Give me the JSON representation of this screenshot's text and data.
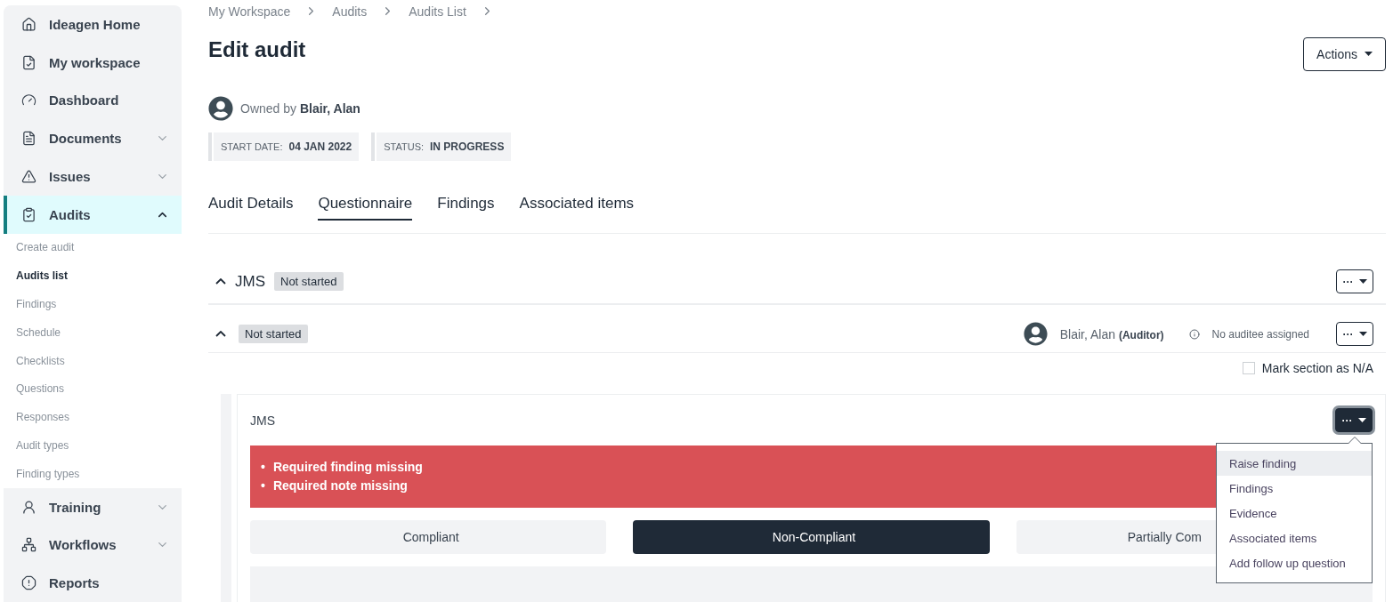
{
  "sidebar": {
    "items": [
      {
        "label": "Ideagen Home",
        "selected": false
      },
      {
        "label": "My workspace",
        "selected": false
      },
      {
        "label": "Dashboard",
        "selected": false
      },
      {
        "label": "Documents",
        "selected": false,
        "expanded": false
      },
      {
        "label": "Issues",
        "selected": false,
        "expanded": false
      },
      {
        "label": "Audits",
        "selected": true,
        "expanded": true,
        "children": [
          {
            "label": "Create audit",
            "selected": false
          },
          {
            "label": "Audits list",
            "selected": true
          },
          {
            "label": "Findings",
            "selected": false
          },
          {
            "label": "Schedule",
            "selected": false
          },
          {
            "label": "Checklists",
            "selected": false
          },
          {
            "label": "Questions",
            "selected": false
          },
          {
            "label": "Responses",
            "selected": false
          },
          {
            "label": "Audit types",
            "selected": false
          },
          {
            "label": "Finding types",
            "selected": false
          }
        ]
      },
      {
        "label": "Training",
        "selected": false,
        "expanded": false
      },
      {
        "label": "Workflows",
        "selected": false,
        "expanded": false
      },
      {
        "label": "Reports",
        "selected": false
      }
    ]
  },
  "breadcrumb": [
    "My Workspace",
    "Audits",
    "Audits List"
  ],
  "title": "Edit audit",
  "actions_button": "Actions",
  "owner": "Owned by **Blair, Alan**",
  "meta": [
    {
      "label": "START DATE:",
      "value": "04 JAN 2022"
    },
    {
      "label": "STATUS:",
      "value": "IN PROGRESS"
    }
  ],
  "tabs": [
    {
      "label": "Audit Details",
      "selected": false
    },
    {
      "label": "Questionnaire",
      "selected": true
    },
    {
      "label": "Findings",
      "selected": false
    },
    {
      "label": "Associated items",
      "selected": false
    }
  ],
  "section": {
    "title": "JMS",
    "status": "Not started",
    "expanded": true,
    "more_button": "···"
  },
  "subsection": {
    "status": "Not started",
    "expanded": true,
    "auditor": "Blair, Alan **(Auditor)**",
    "auditee_note": "No auditee assigned",
    "more_button": "···",
    "mark_na": {
      "label": "Mark section as N/A",
      "checked": false
    }
  },
  "question": {
    "title": "JMS",
    "more_button": "···",
    "error_bullet": "•",
    "errors": [
      "Required finding missing",
      "Required note missing"
    ],
    "responses": [
      {
        "label": "Compliant",
        "selected": false
      },
      {
        "label": "Non-Compliant",
        "selected": true
      },
      {
        "label": "Partially Com",
        "selected": false
      }
    ],
    "menu": {
      "open": true,
      "items": [
        {
          "label": "Raise finding",
          "selected": true
        },
        {
          "label": "Findings",
          "selected": false
        },
        {
          "label": "Evidence",
          "selected": false
        },
        {
          "label": "Associated items",
          "selected": false
        },
        {
          "label": "Add follow up question",
          "selected": false
        }
      ]
    }
  }
}
